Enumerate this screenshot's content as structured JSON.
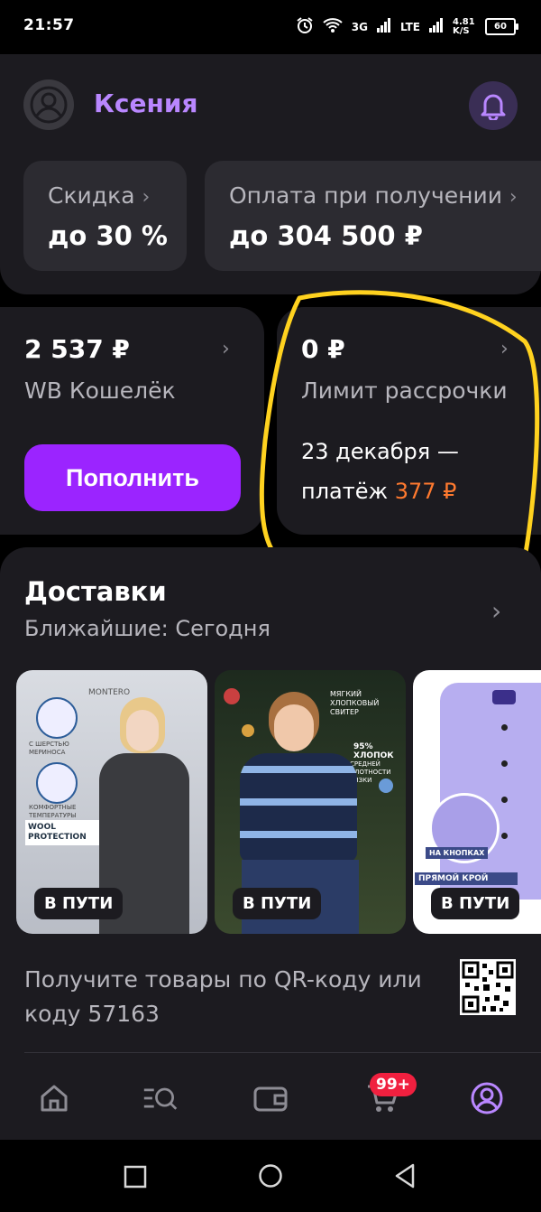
{
  "status": {
    "time": "21:57",
    "network1": "3G",
    "network2": "LTE",
    "speed": "4.81 K/S",
    "battery": "60"
  },
  "profile": {
    "name": "Ксения"
  },
  "discount": {
    "label": "Скидка",
    "value": "до 30 %"
  },
  "cod": {
    "label": "Оплата при получении",
    "value": "до 304 500 ₽"
  },
  "wallet": {
    "amount": "2 537 ₽",
    "label": "WB Кошелёк",
    "button": "Пополнить"
  },
  "installment": {
    "amount": "0 ₽",
    "label": "Лимит рассрочки",
    "date_line": "23 декабря —",
    "payment_prefix": "платёж ",
    "payment_amount": "377 ₽"
  },
  "deliveries": {
    "title": "Доставки",
    "subtitle": "Ближайшие: Сегодня",
    "items": [
      {
        "status": "В ПУТИ",
        "brand": "MONTERO",
        "tags": [
          "С ШЕРСТЬЮ МЕРИНОСА",
          "КОМФОРТНЫЕ ТЕМПЕРАТУРЫ",
          "WOOL PROTECTION"
        ]
      },
      {
        "status": "В ПУТИ",
        "tags": [
          "МЯГКИЙ ХЛОПКОВЫЙ СВИТЕР",
          "95% ХЛОПОК",
          "СРЕДНЕЙ ПЛОТНОСТИ ВЯЗКИ"
        ]
      },
      {
        "status": "В ПУТИ",
        "tags": [
          "НА КНОПКАХ",
          "ПРЯМОЙ КРОЙ"
        ]
      }
    ],
    "qr_text": "Получите товары по QR-коду или коду 57163"
  },
  "nav": {
    "cart_badge": "99+"
  },
  "colors": {
    "accent": "#9b24ff",
    "accent_text": "#b987ff",
    "orange": "#ff7a2f",
    "annotation": "#ffd21f"
  }
}
